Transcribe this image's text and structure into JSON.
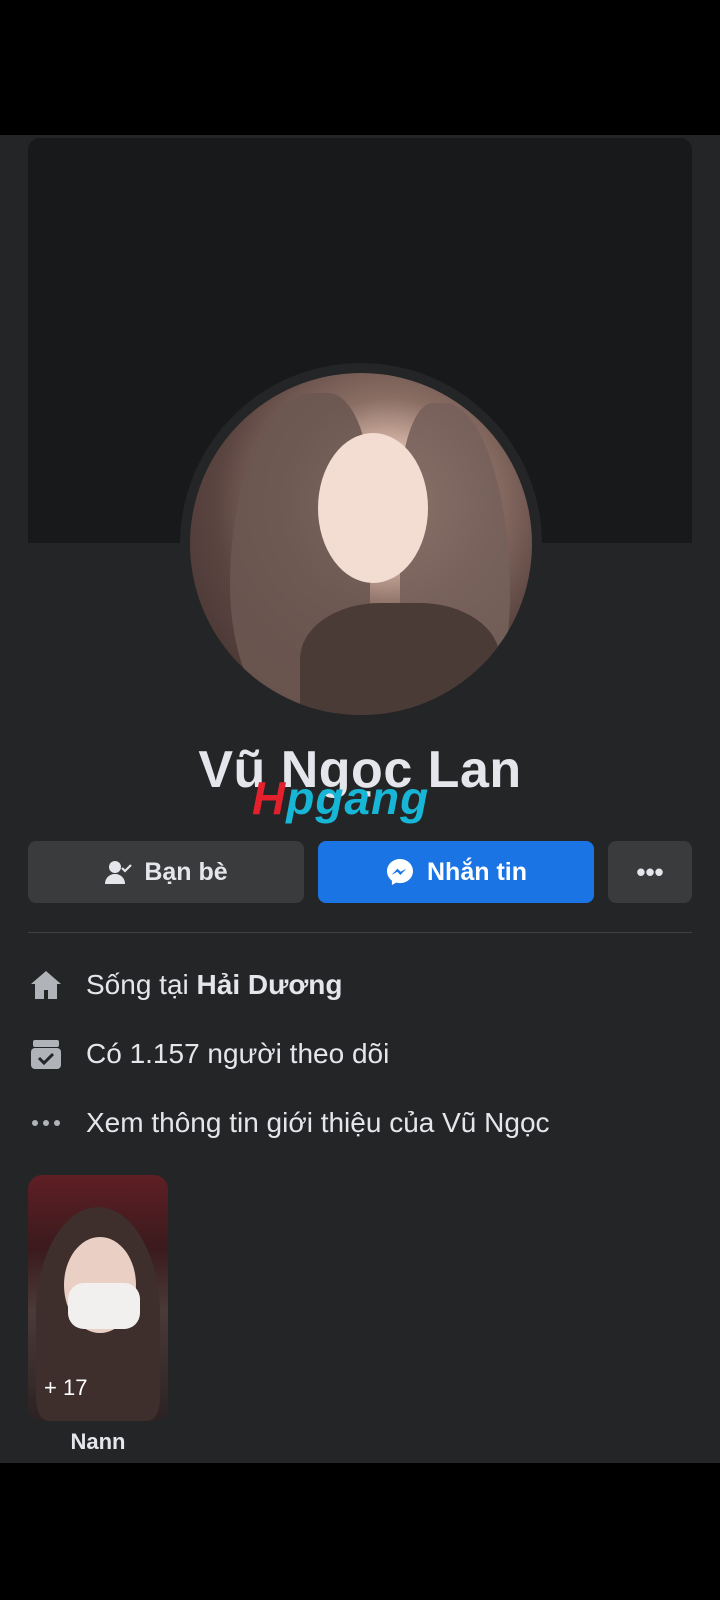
{
  "profile": {
    "name": "Vũ Ngọc Lan",
    "watermark": {
      "part1": "H",
      "part2": "pgang"
    }
  },
  "actions": {
    "friends_label": "Bạn bè",
    "message_label": "Nhắn tin",
    "more_label": "•••"
  },
  "intro": {
    "lives_prefix": "Sống tại ",
    "lives_place": "Hải Dương",
    "followers_text": "Có 1.157 người theo dõi",
    "see_about_text": "Xem thông tin giới thiệu của Vũ Ngọc"
  },
  "friends": [
    {
      "name": "Nann",
      "count_label": "+ 17"
    }
  ],
  "colors": {
    "background": "#242526",
    "button_primary": "#1b74e4",
    "button_secondary": "#3a3b3c"
  }
}
